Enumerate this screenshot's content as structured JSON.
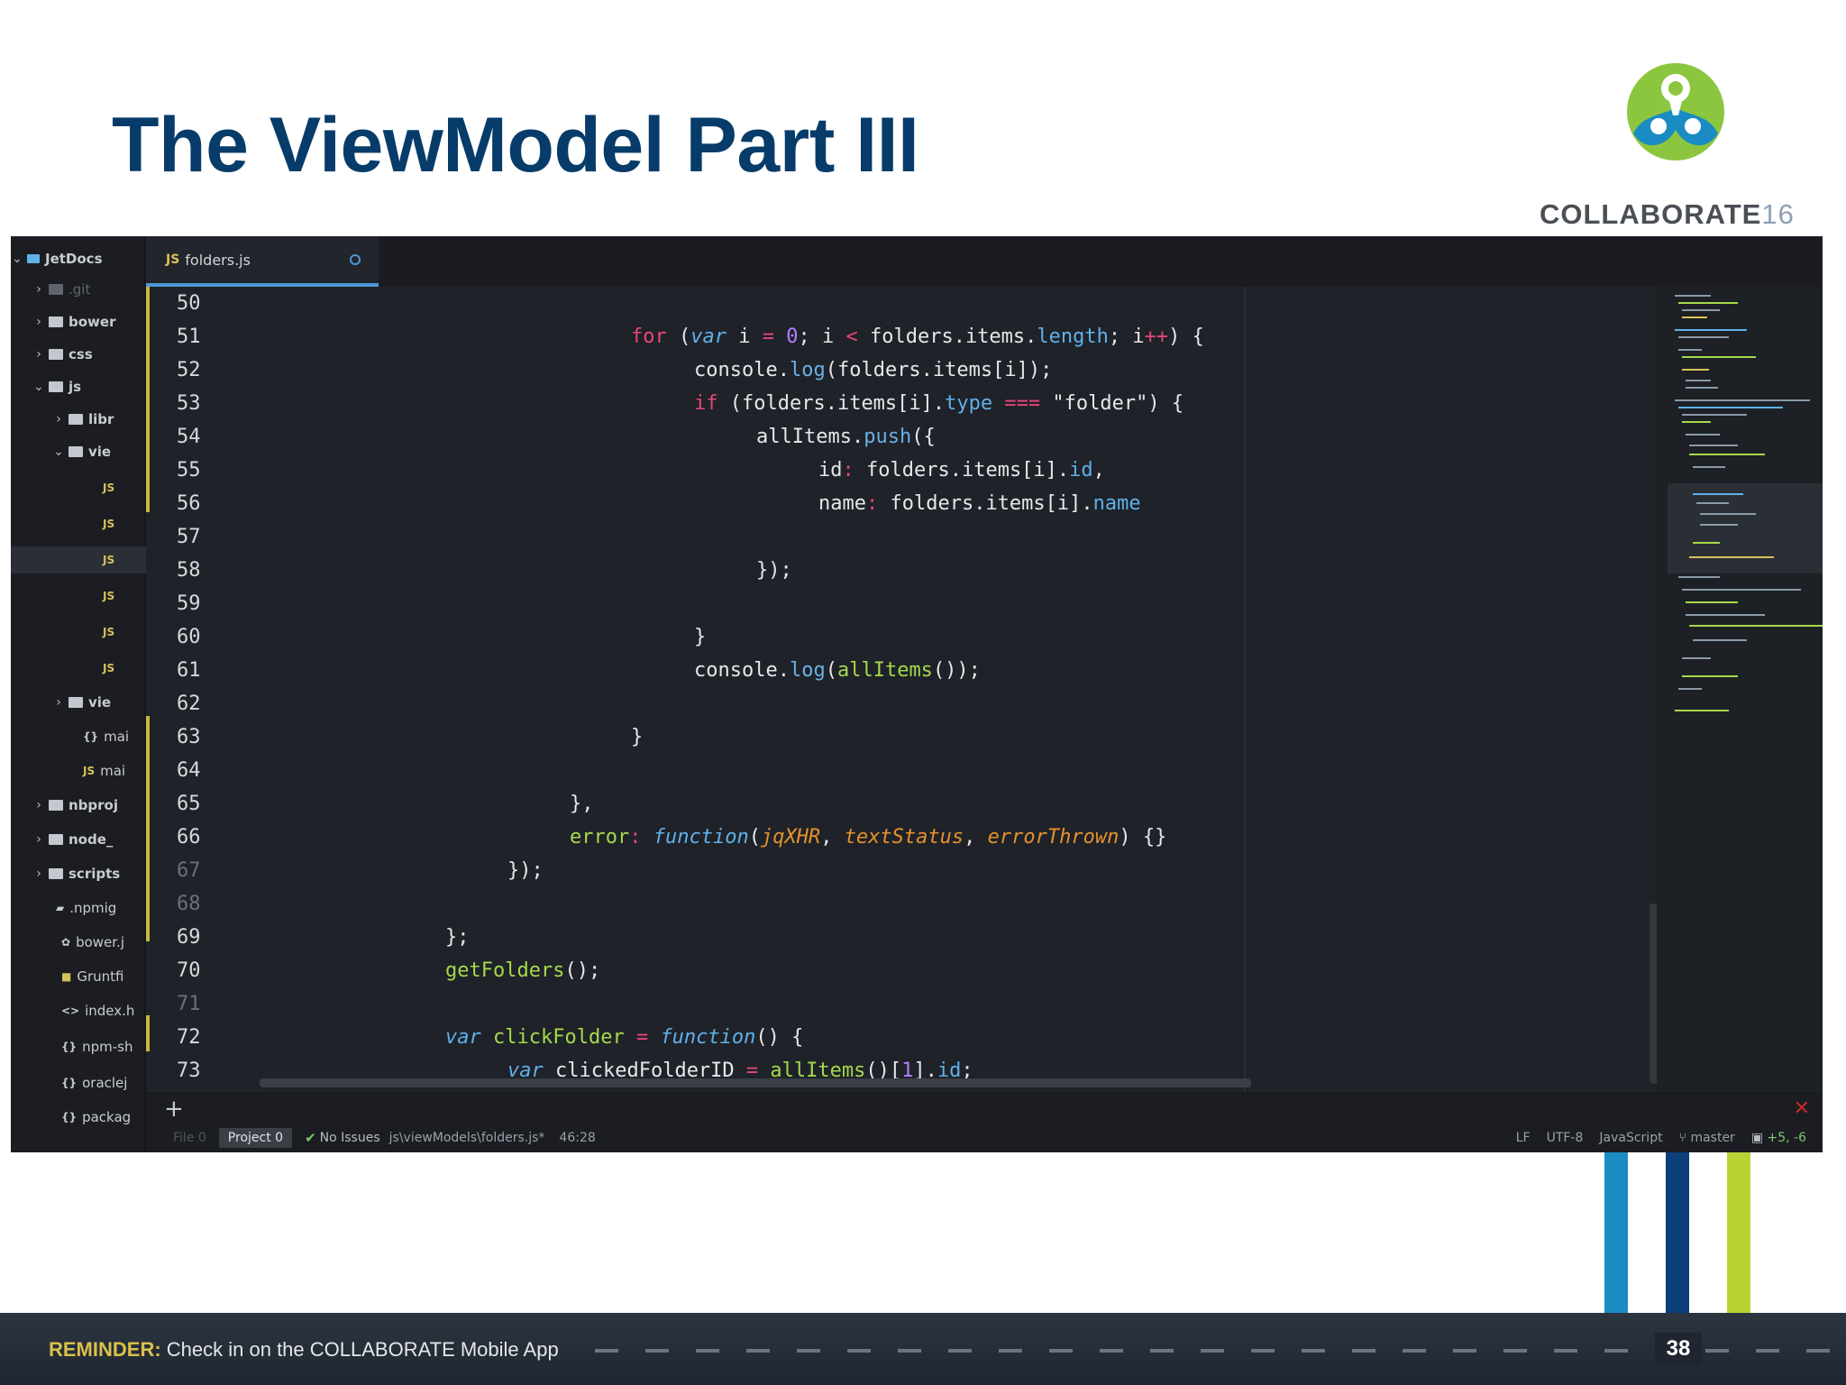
{
  "slide": {
    "title": "The ViewModel Part III",
    "logo": {
      "text": "COLLABORATE",
      "year": "16"
    },
    "footer": {
      "reminder_label": "REMINDER:",
      "reminder_text": " Check in on the COLLABORATE Mobile App",
      "page_number": "38"
    },
    "accent_bars": [
      "#1a8cc3",
      "#0b3f7a",
      "#b9d334"
    ]
  },
  "editor": {
    "project_name": "JetDocs",
    "tree": [
      ".git",
      "bower",
      "css",
      "js",
      "libr",
      "vie",
      "vie",
      "mai",
      "mai",
      "nbproj",
      "node_",
      "scripts",
      ".npmig",
      "bower.j",
      "Gruntfi",
      "index.h",
      "npm-sh",
      "oraclej",
      "packag"
    ],
    "tab": {
      "label": "folders.js"
    },
    "line_numbers": [
      "50",
      "51",
      "52",
      "53",
      "54",
      "55",
      "56",
      "57",
      "58",
      "59",
      "60",
      "61",
      "62",
      "63",
      "64",
      "65",
      "66",
      "67",
      "68",
      "69",
      "70",
      "71",
      "72",
      "73"
    ],
    "code": [
      {
        "a": "for",
        "b": " (",
        "c": "var",
        "d": " i ",
        "e": "=",
        "f": " 0",
        "g": "; i ",
        "h": "<",
        "i": " folders.items.",
        "j": "length",
        "k": "; i",
        "l": "++",
        "m": ") {"
      },
      {
        "a": "console.",
        "b": "log",
        "c": "(folders.items[i]);"
      },
      {
        "a": "if",
        "b": " (folders.items[i].",
        "c": "type",
        "d": " === ",
        "e": "\"folder\"",
        "f": ") {"
      },
      {
        "a": "allItems.",
        "b": "push",
        "c": "({"
      },
      {
        "a": "id",
        "b": ": ",
        "c": "folders.items[i].",
        "d": "id",
        "e": ","
      },
      {
        "a": "name",
        "b": ": ",
        "c": "folders.items[i].",
        "d": "name"
      },
      {
        "a": "});"
      },
      {
        "a": "}"
      },
      {
        "a": "console.",
        "b": "log",
        "c": "(",
        "d": "allItems",
        "e": "());"
      },
      {
        "a": "}"
      },
      {
        "a": "},"
      },
      {
        "a": "error",
        "b": ": ",
        "c": "function",
        "d": "(",
        "e": "jqXHR",
        "f": ", ",
        "g": "textStatus",
        "h": ", ",
        "i": "errorThrown",
        "j": ") {}"
      },
      {
        "a": "});"
      },
      {
        "a": "};"
      },
      {
        "a": "getFolders",
        "b": "();"
      },
      {
        "a": "var",
        "b": " clickFolder ",
        "c": "=",
        "d": " ",
        "e": "function",
        "f": "() {"
      },
      {
        "a": "var",
        "b": " clickedFolderID ",
        "c": "=",
        "d": " ",
        "e": "allItems",
        "f": "()[",
        "g": "1",
        "h": "].",
        "i": "id",
        "j": ";"
      }
    ],
    "status_bar": {
      "file_label": "File 0",
      "project_label": "Project 0",
      "issues": "No Issues",
      "path": "js\\viewModels\\folders.js*",
      "cursor": "46:28",
      "line_ending": "LF",
      "encoding": "UTF-8",
      "grammar": "JavaScript",
      "branch": "master",
      "diff": "+5, -6"
    }
  }
}
